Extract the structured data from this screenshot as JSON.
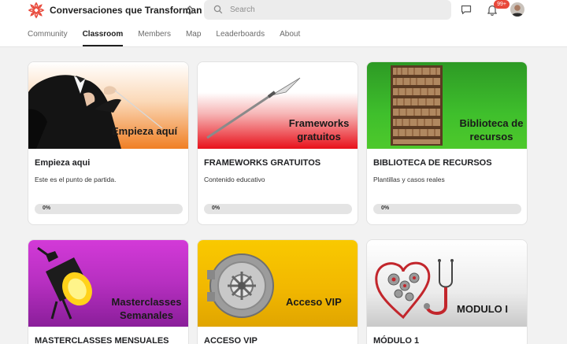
{
  "header": {
    "community_name": "Conversaciones que Transforman",
    "search_placeholder": "Search",
    "notification_count": "99+",
    "brand_color": "#e8483a"
  },
  "tabs": [
    {
      "label": "Community",
      "active": false
    },
    {
      "label": "Classroom",
      "active": true
    },
    {
      "label": "Members",
      "active": false
    },
    {
      "label": "Map",
      "active": false
    },
    {
      "label": "Leaderboards",
      "active": false
    },
    {
      "label": "About",
      "active": false
    }
  ],
  "courses": [
    {
      "banner_text": "Empieza aquí",
      "title": "Empieza aqui",
      "description": "Este es el punto de partida.",
      "progress": "0%",
      "banner_colors": [
        "#ffffff",
        "#f07f24"
      ]
    },
    {
      "banner_text": "Frameworks gratuitos",
      "title": "FRAMEWORKS GRATUITOS",
      "description": "Contenido educativo",
      "progress": "0%",
      "banner_colors": [
        "#ffffff",
        "#e8101a"
      ]
    },
    {
      "banner_text": "Biblioteca de recursos",
      "title": "BIBLIOTECA DE RECURSOS",
      "description": "Plantillas y casos reales",
      "progress": "0%",
      "banner_colors": [
        "#2d9a25",
        "#4ec92c"
      ]
    },
    {
      "banner_text": "Masterclasses Semanales",
      "title": "MASTERCLASSES MENSUALES",
      "description": "",
      "progress": "",
      "banner_colors": [
        "#d33ad8",
        "#8a1e9a"
      ]
    },
    {
      "banner_text": "Acceso VIP",
      "title": "ACCESO VIP",
      "description": "",
      "progress": "",
      "banner_colors": [
        "#f9c900",
        "#e0a500"
      ]
    },
    {
      "banner_text": "MODULO I",
      "title": "MÓDULO 1",
      "description": "",
      "progress": "",
      "banner_colors": [
        "#ffffff",
        "#c9c9c9"
      ]
    }
  ]
}
